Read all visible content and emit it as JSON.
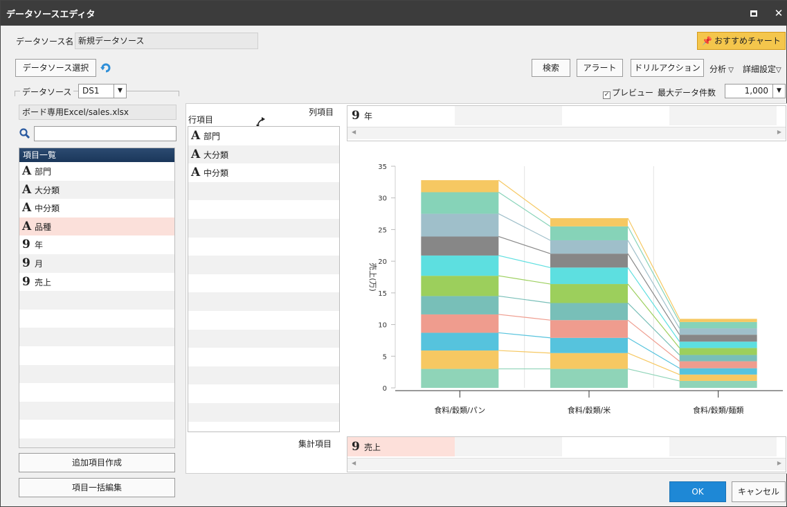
{
  "window": {
    "title": "データソースエディタ"
  },
  "toolbar": {
    "datasource_name_label": "データソース名",
    "datasource_name_value": "新規データソース",
    "recommend_chart_label": "おすすめチャート",
    "select_datasource_label": "データソース選択",
    "search_label": "検索",
    "alert_label": "アラート",
    "drill_action_label": "ドリルアクション",
    "analysis_label": "分析",
    "detail_settings_label": "詳細設定"
  },
  "left_panel": {
    "datasource_label": "データソース",
    "datasource_value": "DS1",
    "file_path": "ボード専用Excel/sales.xlsx",
    "search_placeholder": "",
    "list_header": "項目一覧",
    "items": [
      {
        "icon": "A",
        "label": "部門"
      },
      {
        "icon": "A",
        "label": "大分類"
      },
      {
        "icon": "A",
        "label": "中分類"
      },
      {
        "icon": "A",
        "label": "品種"
      },
      {
        "icon": "9",
        "label": "年"
      },
      {
        "icon": "9",
        "label": "月"
      },
      {
        "icon": "9",
        "label": "売上"
      }
    ],
    "selected_item": "品種",
    "add_item_label": "追加項目作成",
    "bulk_edit_label": "項目一括編集"
  },
  "preview": {
    "preview_label": "プレビュー",
    "preview_checked": true,
    "max_rows_label": "最大データ件数",
    "max_rows_value": "1,000"
  },
  "axes": {
    "column_label": "列項目",
    "column_items": [
      {
        "icon": "9",
        "label": "年"
      }
    ],
    "row_label": "行項目",
    "row_items": [
      {
        "icon": "A",
        "label": "部門"
      },
      {
        "icon": "A",
        "label": "大分類"
      },
      {
        "icon": "A",
        "label": "中分類"
      }
    ],
    "aggregate_label": "集計項目",
    "aggregate_items": [
      {
        "icon": "9",
        "label": "売上"
      }
    ]
  },
  "chart_data": {
    "type": "bar",
    "stacked": true,
    "categories": [
      "食料/穀類/パン",
      "食料/穀類/米",
      "食料/穀類/麺類"
    ],
    "ylabel": "売上(万)",
    "ylim": [
      0,
      35
    ],
    "yticks": [
      0,
      5,
      10,
      15,
      20,
      25,
      30,
      35
    ],
    "grid": true,
    "series": [
      {
        "color": "#8fd4b8",
        "values": [
          3.0,
          3.0,
          1.1
        ]
      },
      {
        "color": "#f6c862",
        "values": [
          2.9,
          2.5,
          1.0
        ]
      },
      {
        "color": "#56c3dd",
        "values": [
          2.8,
          2.4,
          1.0
        ]
      },
      {
        "color": "#ef9c8e",
        "values": [
          2.9,
          2.8,
          1.1
        ]
      },
      {
        "color": "#78bfb8",
        "values": [
          2.9,
          2.7,
          1.0
        ]
      },
      {
        "color": "#9ccf5c",
        "values": [
          3.2,
          3.0,
          1.1
        ]
      },
      {
        "color": "#5ddfe0",
        "values": [
          3.2,
          2.6,
          1.0
        ]
      },
      {
        "color": "#878787",
        "values": [
          3.0,
          2.2,
          1.1
        ]
      },
      {
        "color": "#9fbfca",
        "values": [
          3.6,
          2.1,
          1.0
        ]
      },
      {
        "color": "#86d3b8",
        "values": [
          3.4,
          2.2,
          1.0
        ]
      },
      {
        "color": "#f6c862",
        "values": [
          1.9,
          1.3,
          0.5
        ]
      }
    ]
  },
  "footer": {
    "ok_label": "OK",
    "cancel_label": "キャンセル"
  }
}
